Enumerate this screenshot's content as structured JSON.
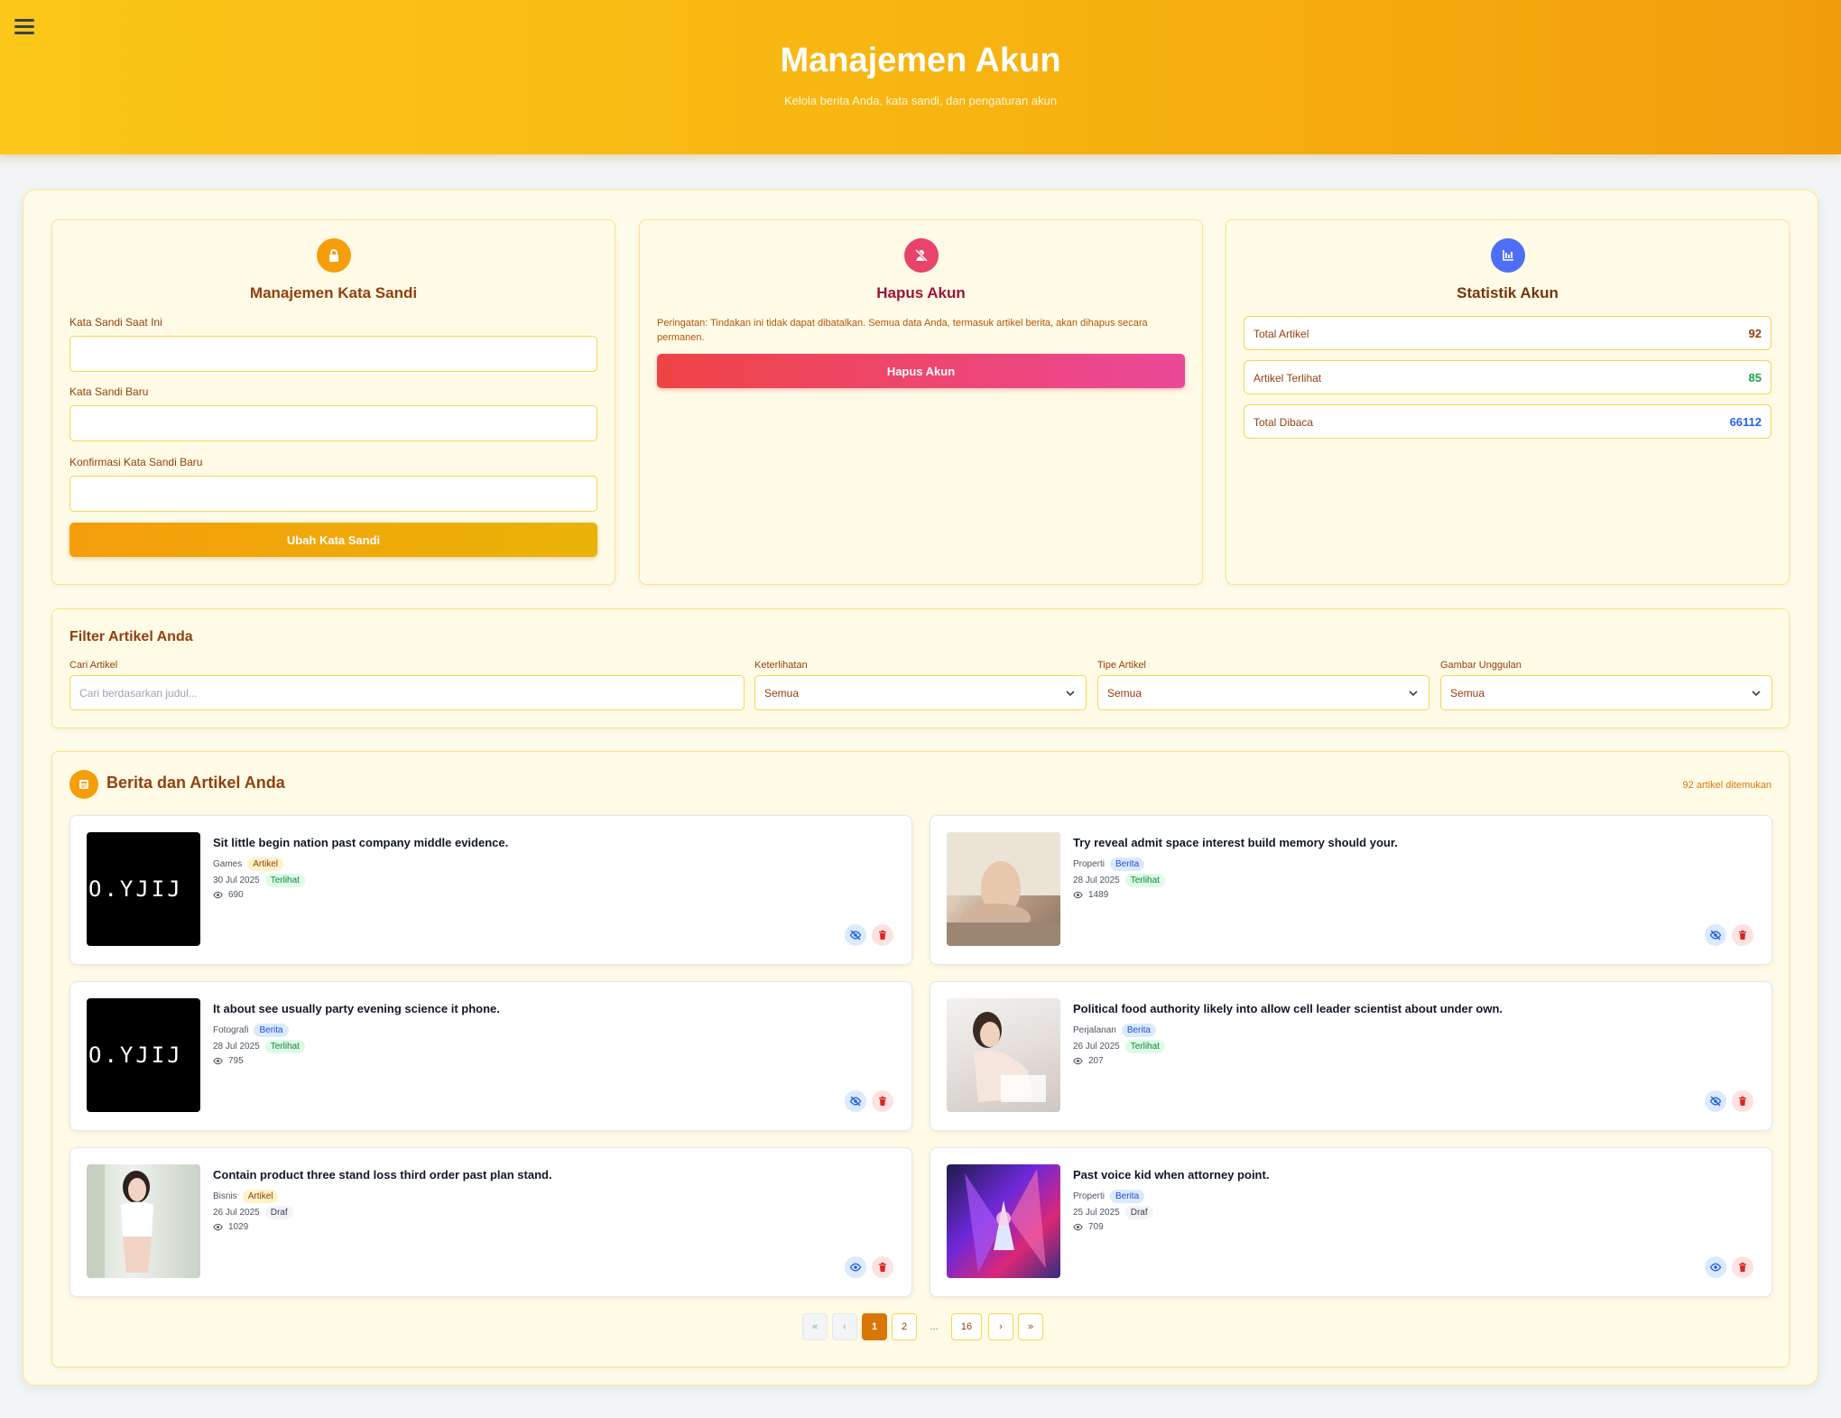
{
  "header": {
    "title": "Manajemen Akun",
    "subtitle": "Kelola berita Anda, kata sandi, dan pengaturan akun"
  },
  "password_card": {
    "title": "Manajemen Kata Sandi",
    "current_label": "Kata Sandi Saat Ini",
    "new_label": "Kata Sandi Baru",
    "confirm_label": "Konfirmasi Kata Sandi Baru",
    "submit_label": "Ubah Kata Sandi"
  },
  "delete_card": {
    "title": "Hapus Akun",
    "warning": "Peringatan: Tindakan ini tidak dapat dibatalkan. Semua data Anda, termasuk artikel berita, akan dihapus secara permanen.",
    "button_label": "Hapus Akun"
  },
  "stats_card": {
    "title": "Statistik Akun",
    "items": [
      {
        "label": "Total Artikel",
        "value": "92",
        "color": "#92400e"
      },
      {
        "label": "Artikel Terlihat",
        "value": "85",
        "color": "#16a34a"
      },
      {
        "label": "Total Dibaca",
        "value": "66112",
        "color": "#2563eb"
      }
    ]
  },
  "filter": {
    "title": "Filter Artikel Anda",
    "search_label": "Cari Artikel",
    "search_placeholder": "Cari berdasarkan judul...",
    "visibility_label": "Keterlihatan",
    "visibility_value": "Semua",
    "type_label": "Tipe Artikel",
    "type_value": "Semua",
    "image_label": "Gambar Unggulan",
    "image_value": "Semua"
  },
  "articles_section": {
    "title": "Berita dan Artikel Anda",
    "count_text": "92 artikel ditemukan"
  },
  "articles": [
    {
      "title": "Sit little begin nation past company middle evidence.",
      "category": "Games",
      "type": "Artikel",
      "date": "30 Jul 2025",
      "status": "Terlihat",
      "views": "690",
      "thumb_text": "O.YJIJ"
    },
    {
      "title": "Try reveal admit space interest build memory should your.",
      "category": "Properti",
      "type": "Berita",
      "date": "28 Jul 2025",
      "status": "Terlihat",
      "views": "1489"
    },
    {
      "title": "It about see usually party evening science it phone.",
      "category": "Fotografi",
      "type": "Berita",
      "date": "28 Jul 2025",
      "status": "Terlihat",
      "views": "795",
      "thumb_text": "O.YJIJ"
    },
    {
      "title": "Political food authority likely into allow cell leader scientist about under own.",
      "category": "Perjalanan",
      "type": "Berita",
      "date": "26 Jul 2025",
      "status": "Terlihat",
      "views": "207"
    },
    {
      "title": "Contain product three stand loss third order past plan stand.",
      "category": "Bisnis",
      "type": "Artikel",
      "date": "26 Jul 2025",
      "status": "Draf",
      "views": "1029"
    },
    {
      "title": "Past voice kid when attorney point.",
      "category": "Properti",
      "type": "Berita",
      "date": "25 Jul 2025",
      "status": "Draf",
      "views": "709"
    }
  ],
  "pagination": {
    "first": "«",
    "prev": "‹",
    "pages": [
      "1",
      "2"
    ],
    "ellipsis": "...",
    "last_page": "16",
    "next": "›",
    "last": "»"
  }
}
